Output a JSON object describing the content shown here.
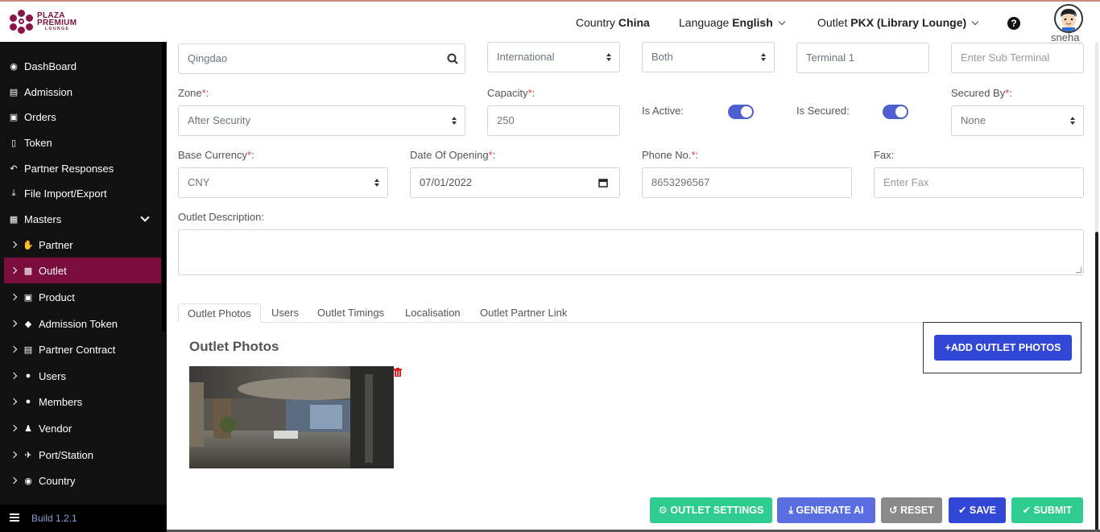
{
  "header": {
    "logo_line1": "PLAZA",
    "logo_line2": "PREMIUM",
    "logo_line3": "LOUNGE",
    "country_label": "Country",
    "country_value": "China",
    "language_label": "Language",
    "language_value": "English",
    "outlet_label": "Outlet",
    "outlet_value": "PKX (Library Lounge)",
    "help_glyph": "?",
    "user_name": "sneha"
  },
  "sidebar": {
    "items": [
      {
        "label": "DashBoard",
        "icon": "dashboard-icon"
      },
      {
        "label": "Admission",
        "icon": "id-card-icon"
      },
      {
        "label": "Orders",
        "icon": "cart-icon"
      },
      {
        "label": "Token",
        "icon": "file-icon"
      },
      {
        "label": "Partner Responses",
        "icon": "reply-icon"
      },
      {
        "label": "File Import/Export",
        "icon": "download-icon"
      },
      {
        "label": "Masters",
        "icon": "sitemap-icon"
      }
    ],
    "sub_items": [
      {
        "label": "Partner",
        "icon": "handshake-icon"
      },
      {
        "label": "Outlet",
        "icon": "building-icon"
      },
      {
        "label": "Product",
        "icon": "gift-icon"
      },
      {
        "label": "Admission Token",
        "icon": "tag-icon"
      },
      {
        "label": "Partner Contract",
        "icon": "briefcase-icon"
      },
      {
        "label": "Users",
        "icon": "user-icon"
      },
      {
        "label": "Members",
        "icon": "users-icon"
      },
      {
        "label": "Vendor",
        "icon": "person-icon"
      },
      {
        "label": "Port/Station",
        "icon": "plane-icon"
      },
      {
        "label": "Country",
        "icon": "globe-icon"
      }
    ],
    "build": "Build 1.2.1"
  },
  "form": {
    "city_value": "Qingdao",
    "type_value": "International",
    "direction_value": "Both",
    "terminal_value": "Terminal 1",
    "sub_terminal_placeholder": "Enter Sub Terminal",
    "zone_label": "Zone",
    "zone_value": "After Security",
    "capacity_label": "Capacity",
    "capacity_value": "250",
    "is_active_label": "Is Active:",
    "is_active": true,
    "is_secured_label": "Is Secured:",
    "is_secured": true,
    "secured_by_label": "Secured By",
    "secured_by_value": "None",
    "base_currency_label": "Base Currency",
    "base_currency_value": "CNY",
    "date_label": "Date Of Opening",
    "date_value": "07/01/2022",
    "phone_label": "Phone No.",
    "phone_value": "8653296567",
    "fax_label": "Fax:",
    "fax_placeholder": "Enter Fax",
    "description_label": "Outlet Description:",
    "req_mark": "*",
    "colon": ":"
  },
  "tabs": [
    "Outlet Photos",
    "Users",
    "Outlet Timings",
    "Localisation",
    "Outlet Partner Link"
  ],
  "photos": {
    "title": "Outlet Photos",
    "add_button": "+ADD OUTLET PHOTOS"
  },
  "actions": {
    "outlet_settings": "OUTLET SETTINGS",
    "generate_ai": "GENERATE AI",
    "reset": "RESET",
    "save": "SAVE",
    "submit": "SUBMIT"
  },
  "colors": {
    "sidebar_bg": "#111111",
    "active_item": "#7b0d3e",
    "green": "#2ecc8f",
    "blue": "#5b6ee1",
    "gray": "#8a8a8a",
    "primary": "#3347d6"
  }
}
